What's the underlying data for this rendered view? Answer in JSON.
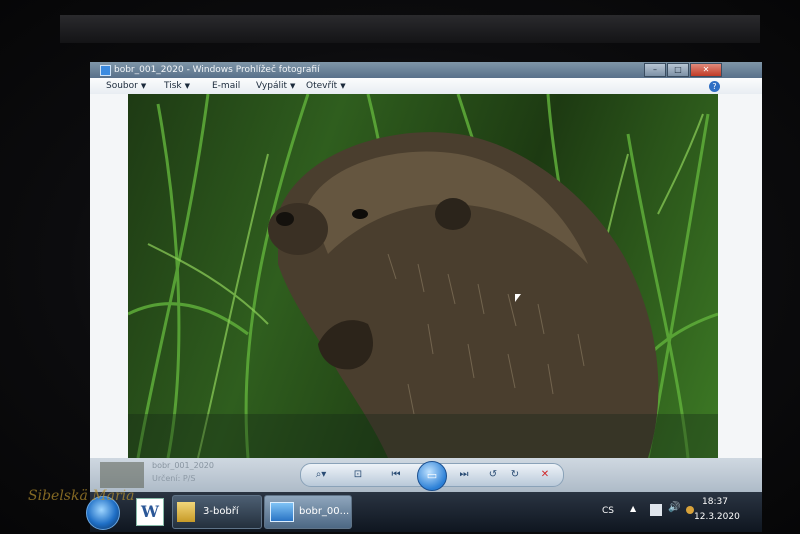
{
  "window": {
    "title": "bobr_001_2020 - Windows Prohlížeč fotografií"
  },
  "menu": {
    "items": [
      {
        "label": "Soubor"
      },
      {
        "label": "Tisk"
      },
      {
        "label": "E-mail"
      },
      {
        "label": "Vypálit"
      },
      {
        "label": "Otevřít"
      }
    ],
    "help_icon": "help-icon"
  },
  "info": {
    "title": "bobr_001_2020",
    "subtitle": "Určení: P/S"
  },
  "controls": {
    "icons": [
      "zoom-icon",
      "fit-icon",
      "previous-icon",
      "slideshow-icon",
      "next-icon",
      "rotate-left-icon",
      "rotate-right-icon",
      "delete-icon"
    ]
  },
  "taskbar": {
    "buttons": [
      {
        "label": "3-bobří"
      },
      {
        "label": "bobr_00..."
      }
    ],
    "language": "CS",
    "time": "18:37",
    "date": "12.3.2020"
  },
  "watermark": "Sibelskä Maria",
  "colors": {
    "accent": "#2b7fd6",
    "close": "#c03b27"
  }
}
